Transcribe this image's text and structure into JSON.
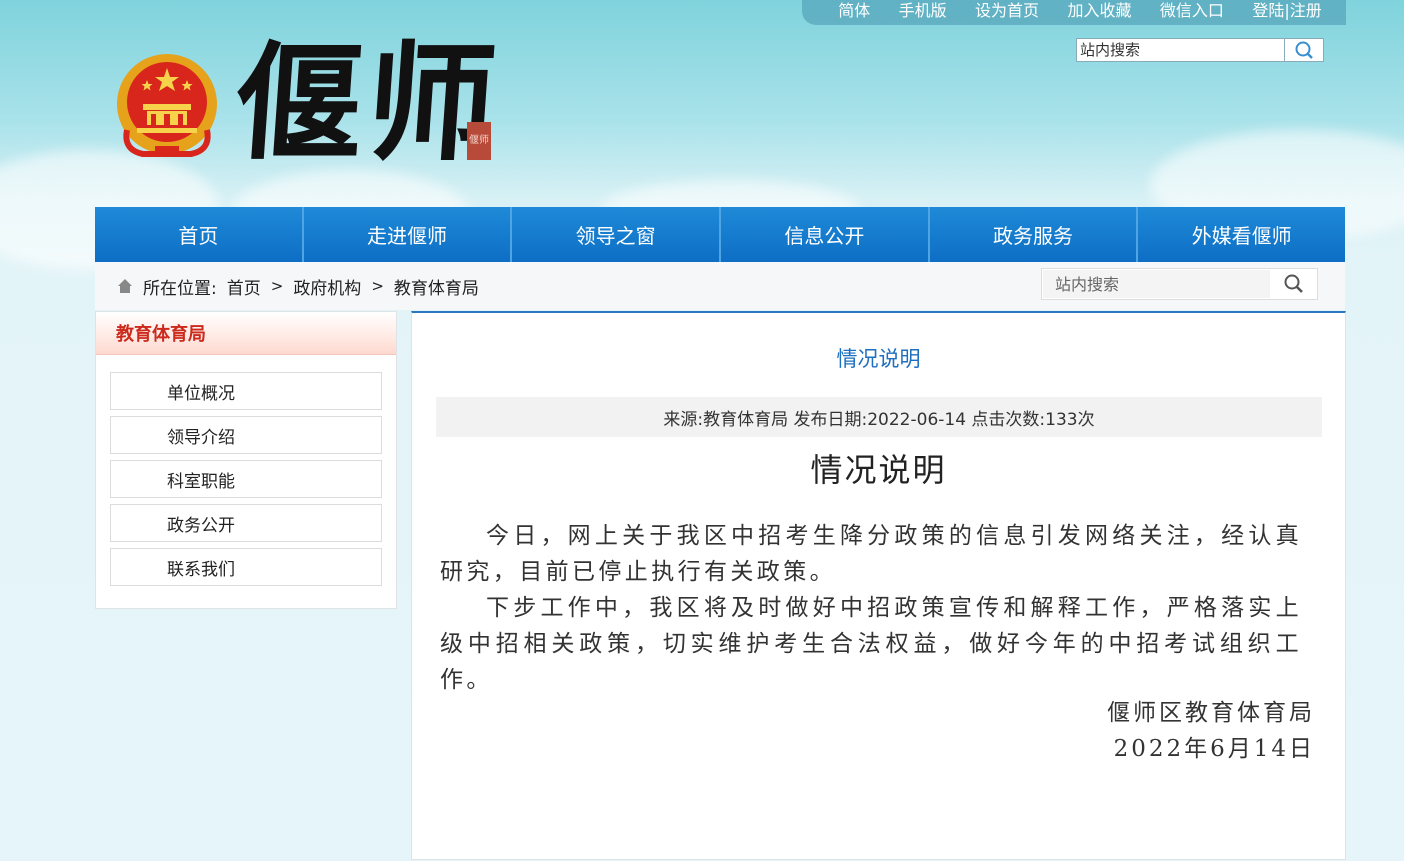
{
  "topbar": {
    "links": [
      "简体",
      "手机版",
      "设为首页",
      "加入收藏",
      "微信入口",
      "登陆|注册"
    ]
  },
  "header": {
    "search_placeholder": "站内搜索",
    "logo_text": "偃师",
    "seal_text": "偃师"
  },
  "nav": {
    "items": [
      "首页",
      "走进偃师",
      "领导之窗",
      "信息公开",
      "政务服务",
      "外媒看偃师"
    ]
  },
  "location": {
    "label": "所在位置:",
    "crumbs": [
      "首页",
      "政府机构",
      "教育体育局"
    ],
    "separator": ">",
    "search_placeholder": "站内搜索"
  },
  "sidebar": {
    "title": "教育体育局",
    "items": [
      "单位概况",
      "领导介绍",
      "科室职能",
      "政务公开",
      "联系我们"
    ]
  },
  "article": {
    "page_title": "情况说明",
    "meta": "来源:教育体育局 发布日期:2022-06-14 点击次数:133次",
    "title": "情况说明",
    "paragraphs": [
      "今日，网上关于我区中招考生降分政策的信息引发网络关注，经认真研究，目前已停止执行有关政策。",
      "下步工作中，我区将及时做好中招政策宣传和解释工作，严格落实上级中招相关政策，切实维护考生合法权益，做好今年的中招考试组织工作。"
    ],
    "signature": "偃师区教育体育局",
    "date": "2022年6月14日"
  },
  "colors": {
    "nav_blue": "#1578cc",
    "sidebar_title_red": "#cc2a1c",
    "page_title_blue": "#1e6fbf"
  },
  "icons": {
    "home": "home-icon",
    "search": "search-icon",
    "emblem": "national-emblem-icon"
  }
}
